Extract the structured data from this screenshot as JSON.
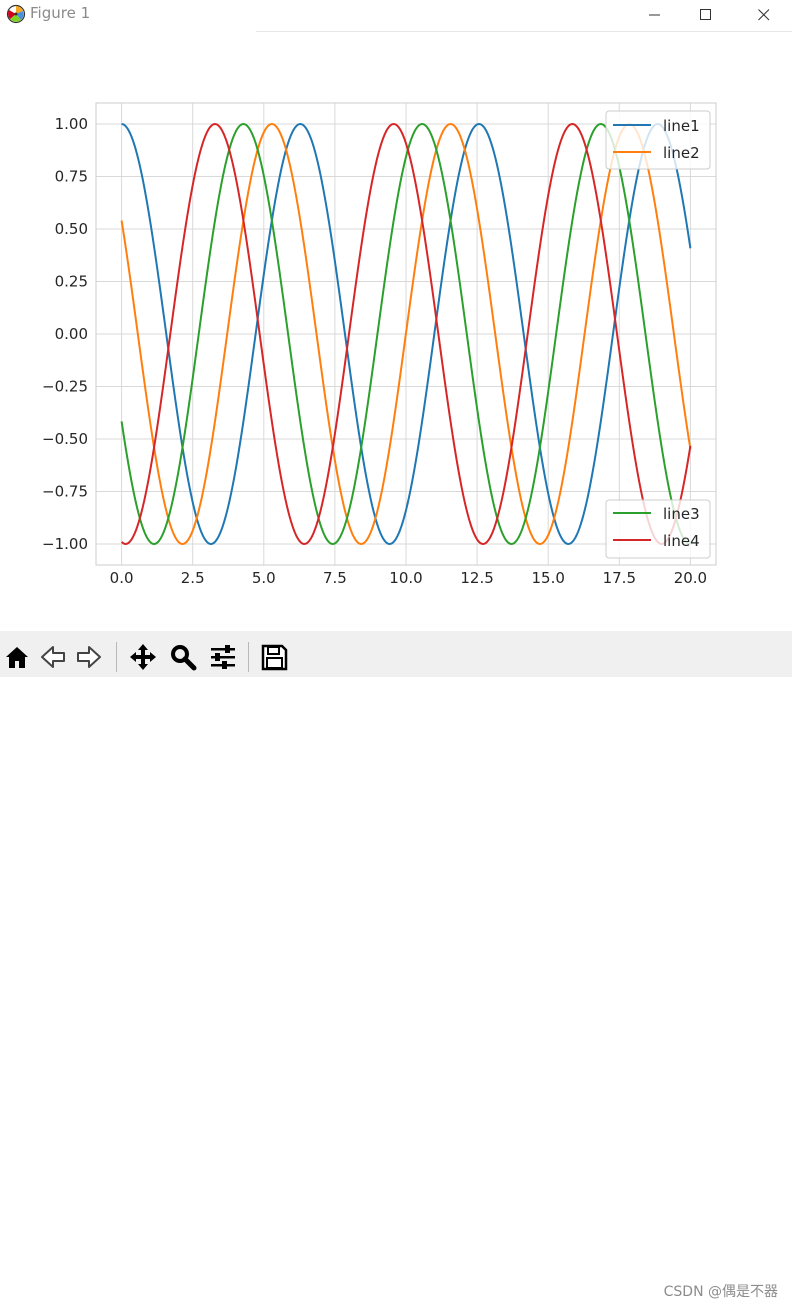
{
  "window": {
    "title": "Figure 1",
    "icons": {
      "app": "matplotlib-logo-icon",
      "minimize": "minimize-icon",
      "maximize": "maximize-icon",
      "close": "close-icon"
    }
  },
  "toolbar": {
    "buttons": [
      {
        "name": "home-button",
        "icon": "home-icon"
      },
      {
        "name": "back-button",
        "icon": "arrow-left-icon"
      },
      {
        "name": "forward-button",
        "icon": "arrow-right-icon"
      },
      {
        "name": "pan-button",
        "icon": "move-icon"
      },
      {
        "name": "zoom-button",
        "icon": "magnifier-icon"
      },
      {
        "name": "configure-subplots-button",
        "icon": "sliders-icon"
      },
      {
        "name": "save-button",
        "icon": "floppy-disk-icon"
      }
    ]
  },
  "watermark": "CSDN @偶是不器",
  "chart_data": {
    "type": "line",
    "title": "",
    "xlabel": "",
    "ylabel": "",
    "xlim": [
      -0.9,
      20.9
    ],
    "ylim": [
      -1.1,
      1.1
    ],
    "grid": true,
    "xticks": [
      "0.0",
      "2.5",
      "5.0",
      "7.5",
      "10.0",
      "12.5",
      "15.0",
      "17.5",
      "20.0"
    ],
    "yticks": [
      "1.00",
      "0.75",
      "0.50",
      "0.25",
      "0.00",
      "−0.25",
      "−0.50",
      "−0.75",
      "−1.00"
    ],
    "x_range": [
      0,
      20
    ],
    "series": [
      {
        "name": "line1",
        "color": "#1f77b4",
        "function": "cos(x)"
      },
      {
        "name": "line2",
        "color": "#ff7f0e",
        "function": "cos(x + 1)"
      },
      {
        "name": "line3",
        "color": "#2ca02c",
        "function": "cos(x + 2)"
      },
      {
        "name": "line4",
        "color": "#d62728",
        "function": "cos(x + 3)"
      }
    ],
    "legends": [
      {
        "placement": "upper right",
        "entries": [
          "line1",
          "line2"
        ]
      },
      {
        "placement": "lower right",
        "entries": [
          "line3",
          "line4"
        ]
      }
    ]
  }
}
